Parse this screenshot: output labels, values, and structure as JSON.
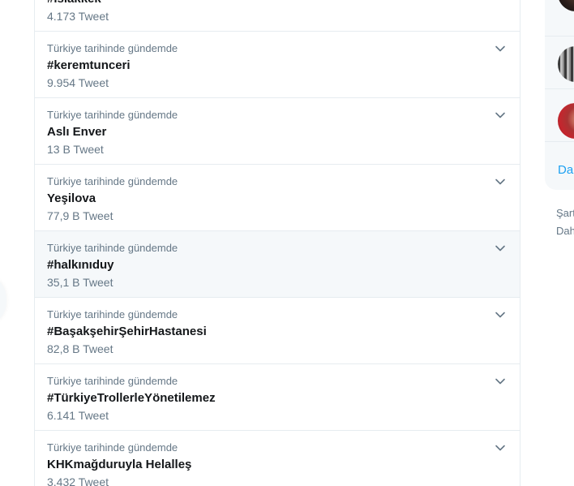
{
  "colors": {
    "accent": "#1da1f2",
    "secondary_text": "#657786",
    "primary_text": "#14171a",
    "hover_bg": "#f5f8fa",
    "border": "#e6ecf0"
  },
  "trends": [
    {
      "context": "",
      "name": "#ıslakkek",
      "count": "4.173 Tweet",
      "hovered": false
    },
    {
      "context": "Türkiye tarihinde gündemde",
      "name": "#keremtunceri",
      "count": "9.954 Tweet",
      "hovered": false
    },
    {
      "context": "Türkiye tarihinde gündemde",
      "name": "Aslı Enver",
      "count": "13 B Tweet",
      "hovered": false
    },
    {
      "context": "Türkiye tarihinde gündemde",
      "name": "Yeşilova",
      "count": "77,9 B Tweet",
      "hovered": false
    },
    {
      "context": "Türkiye tarihinde gündemde",
      "name": "#halkınıduy",
      "count": "35,1 B Tweet",
      "hovered": true
    },
    {
      "context": "Türkiye tarihinde gündemde",
      "name": "#BaşakşehirŞehirHastanesi",
      "count": "82,8 B Tweet",
      "hovered": false
    },
    {
      "context": "Türkiye tarihinde gündemde",
      "name": "#TürkiyeTrollerleYönetilemez",
      "count": "6.141 Tweet",
      "hovered": false
    },
    {
      "context": "Türkiye tarihinde gündemde",
      "name": "KHKmağduruyla Helalleş",
      "count": "3.432 Tweet",
      "hovered": false
    }
  ],
  "chevron_icon": "chevron-down-icon",
  "sidebar": {
    "show_more_label": "Dah",
    "footer_links": [
      "Şart",
      "Dah"
    ]
  }
}
